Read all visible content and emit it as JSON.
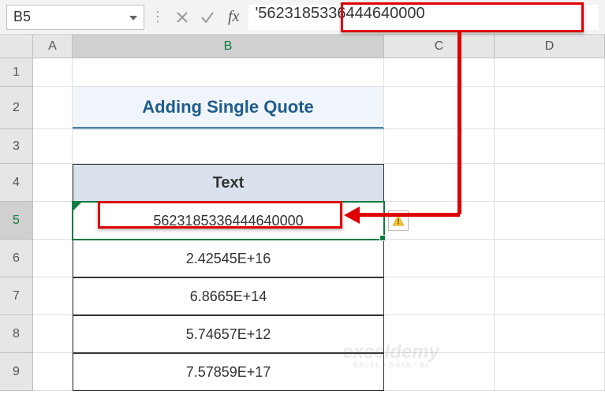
{
  "name_box": {
    "value": "B5"
  },
  "formula_bar": {
    "value": "'5623185336444640000"
  },
  "columns": [
    "A",
    "B",
    "C",
    "D"
  ],
  "rows": [
    "1",
    "2",
    "3",
    "4",
    "5",
    "6",
    "7",
    "8",
    "9"
  ],
  "active": {
    "col": "B",
    "row": "5"
  },
  "title": "Adding Single Quote",
  "table": {
    "header": "Text",
    "data": [
      "5623185336444640000",
      "2.42545E+16",
      "6.8665E+14",
      "5.74657E+12",
      "7.57859E+17"
    ]
  },
  "watermark": {
    "main": "exceldemy",
    "sub": "EXCEL · DATA · BI"
  }
}
